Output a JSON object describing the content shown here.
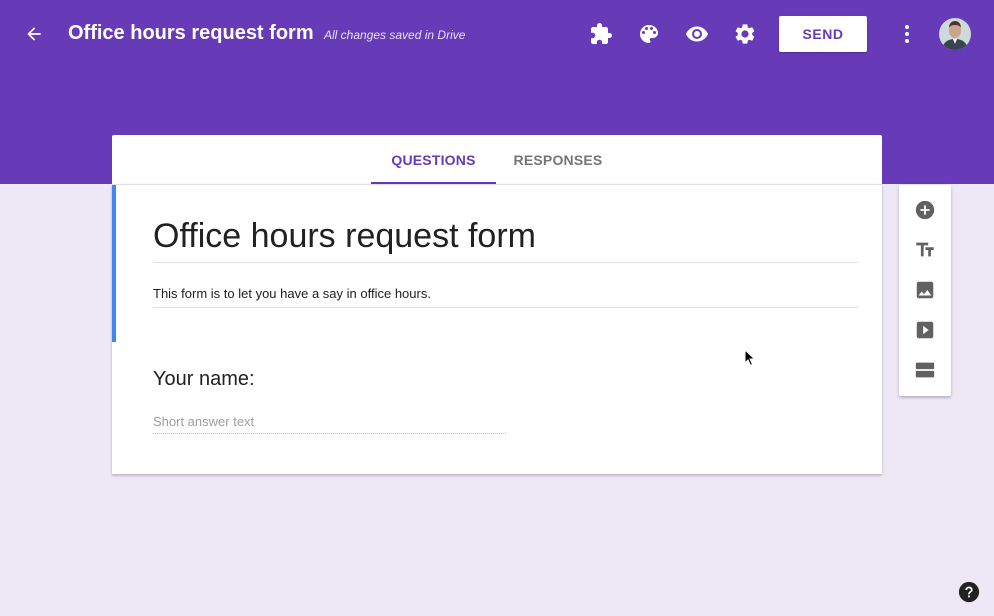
{
  "colors": {
    "brand": "#673ab7",
    "background": "#ede7f6",
    "accent_bar": "#4285f4",
    "tab_inactive": "#757575"
  },
  "header": {
    "back_icon": "arrow-back-icon",
    "title": "Office hours request form",
    "save_status": "All changes saved in Drive",
    "toolbar_icons": [
      "puzzle-addons-icon",
      "palette-icon",
      "eye-preview-icon",
      "gear-settings-icon"
    ],
    "send_label": "SEND",
    "more_icon": "more-vert-icon",
    "avatar_icon": "user-avatar"
  },
  "tabs": [
    {
      "label": "QUESTIONS",
      "active": true
    },
    {
      "label": "RESPONSES",
      "active": false
    }
  ],
  "form": {
    "title": "Office hours request form",
    "description": "This form is to let you have a say in office hours.",
    "questions": [
      {
        "title": "Your name:",
        "answer_placeholder": "Short answer text"
      }
    ]
  },
  "side_toolbar": {
    "icons": [
      "add-circle-icon",
      "title-text-icon",
      "image-icon",
      "video-icon",
      "section-icon"
    ]
  },
  "help_icon": "help-icon"
}
